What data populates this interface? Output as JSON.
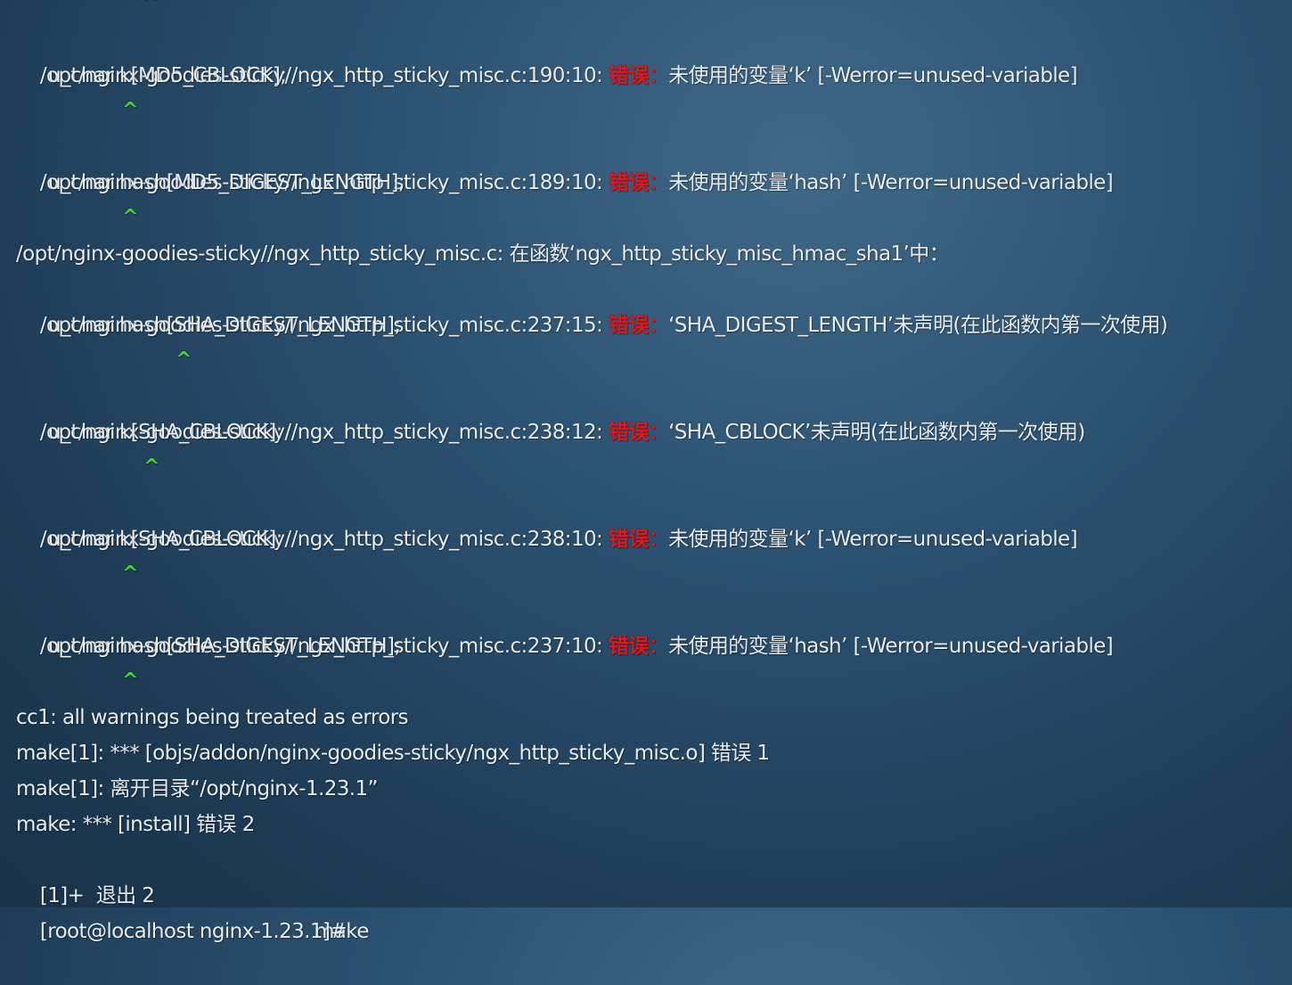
{
  "colors": {
    "background": "#2b5170",
    "text": "#e9eef2",
    "error_label": "#e8141a",
    "caret": "#33e02a"
  },
  "terminal": {
    "line_1": {
      "caret": "^"
    },
    "line_2": {
      "location": "/opt/nginx-goodies-sticky//ngx_http_sticky_misc.c:190:10: ",
      "error_label": "错误",
      "colon": "：",
      "message": "未使用的变量‘k’ [-Werror=unused-variable]"
    },
    "line_3": {
      "code": "u_char k[MD5_CBLOCK];"
    },
    "line_4": {
      "caret": "^"
    },
    "line_5": {
      "location": "/opt/nginx-goodies-sticky//ngx_http_sticky_misc.c:189:10: ",
      "error_label": "错误",
      "colon": "：",
      "message": "未使用的变量‘hash’ [-Werror=unused-variable]"
    },
    "line_6": {
      "code": "u_char hash[MD5_DIGEST_LENGTH];"
    },
    "line_7": {
      "caret": "^"
    },
    "line_8": {
      "text": "/opt/nginx-goodies-sticky//ngx_http_sticky_misc.c: 在函数‘ngx_http_sticky_misc_hmac_sha1’中："
    },
    "line_9": {
      "location": "/opt/nginx-goodies-sticky//ngx_http_sticky_misc.c:237:15: ",
      "error_label": "错误",
      "colon": "：",
      "message": "‘SHA_DIGEST_LENGTH’未声明(在此函数内第一次使用)"
    },
    "line_10": {
      "code": "u_char hash[SHA_DIGEST_LENGTH];"
    },
    "line_11": {
      "caret": "^"
    },
    "line_12": {
      "location": "/opt/nginx-goodies-sticky//ngx_http_sticky_misc.c:238:12: ",
      "error_label": "错误",
      "colon": "：",
      "message": "‘SHA_CBLOCK’未声明(在此函数内第一次使用)"
    },
    "line_13": {
      "code": "u_char k[SHA_CBLOCK];"
    },
    "line_14": {
      "caret": "^"
    },
    "line_15": {
      "location": "/opt/nginx-goodies-sticky//ngx_http_sticky_misc.c:238:10: ",
      "error_label": "错误",
      "colon": "：",
      "message": "未使用的变量‘k’ [-Werror=unused-variable]"
    },
    "line_16": {
      "code": "u_char k[SHA_CBLOCK];"
    },
    "line_17": {
      "caret": "^"
    },
    "line_18": {
      "location": "/opt/nginx-goodies-sticky//ngx_http_sticky_misc.c:237:10: ",
      "error_label": "错误",
      "colon": "：",
      "message": "未使用的变量‘hash’ [-Werror=unused-variable]"
    },
    "line_19": {
      "code": "u_char hash[SHA_DIGEST_LENGTH];"
    },
    "line_20": {
      "caret": "^"
    },
    "line_21": {
      "text": "cc1: all warnings being treated as errors"
    },
    "line_22": {
      "text": "make[1]: *** [objs/addon/nginx-goodies-sticky/ngx_http_sticky_misc.o] 错误 1"
    },
    "line_23": {
      "text": "make[1]: 离开目录“/opt/nginx-1.23.1”"
    },
    "line_24": {
      "text": "make: *** [install] 错误 2"
    },
    "line_25": {
      "job": "[1]+  退出 2",
      "command": "make"
    },
    "line_26": {
      "prompt": "[root@localhost nginx-1.23.1]#"
    }
  }
}
